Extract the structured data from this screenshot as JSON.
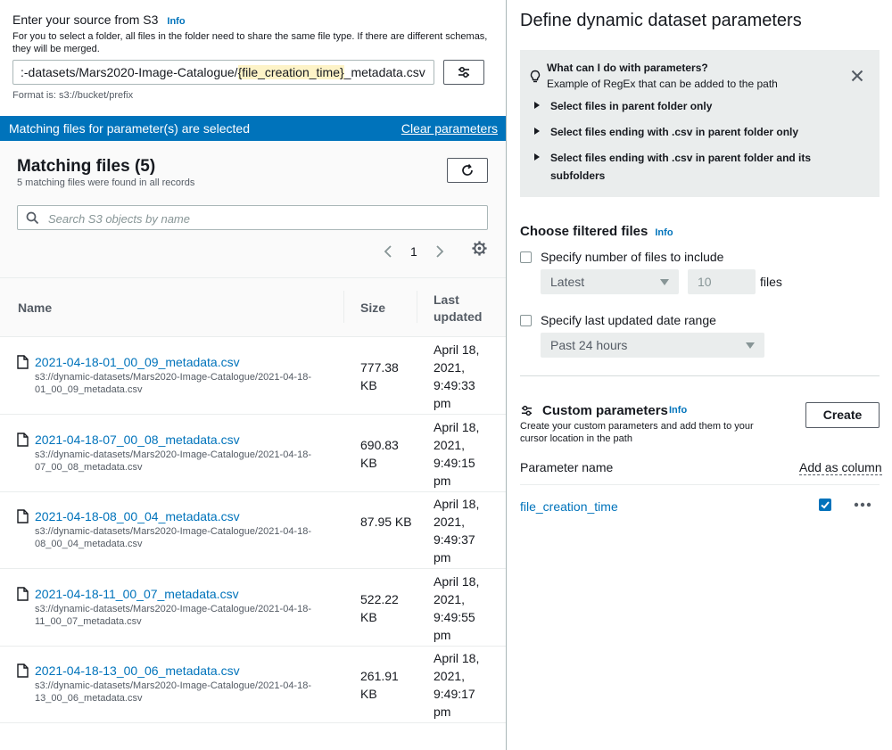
{
  "left": {
    "source_title": "Enter your source from S3",
    "info": "Info",
    "source_description": "For you to select a folder, all files in the folder need to share the same file type. If there are different schemas, they will be merged.",
    "path_prefix": ":-datasets/Mars2020-Image-Catalogue/",
    "path_param": "{file_creation_time}",
    "path_suffix": "_metadata.csv",
    "format_hint": "Format is: s3://bucket/prefix",
    "banner_message": "Matching files for parameter(s) are selected",
    "clear_parameters": "Clear parameters",
    "matching_title": "Matching files (5)",
    "matching_subtitle": "5 matching files were found in all records",
    "search_placeholder": "Search S3 objects by name",
    "page_number": "1",
    "columns": {
      "name": "Name",
      "size": "Size",
      "last_updated": "Last updated"
    },
    "files": [
      {
        "name": "2021-04-18-01_00_09_metadata.csv",
        "path": "s3://dynamic-datasets/Mars2020-Image-Catalogue/2021-04-18-01_00_09_metadata.csv",
        "size": "777.38 KB",
        "updated": "April 18, 2021, 9:49:33 pm"
      },
      {
        "name": "2021-04-18-07_00_08_metadata.csv",
        "path": "s3://dynamic-datasets/Mars2020-Image-Catalogue/2021-04-18-07_00_08_metadata.csv",
        "size": "690.83 KB",
        "updated": "April 18, 2021, 9:49:15 pm"
      },
      {
        "name": "2021-04-18-08_00_04_metadata.csv",
        "path": "s3://dynamic-datasets/Mars2020-Image-Catalogue/2021-04-18-08_00_04_metadata.csv",
        "size": "87.95 KB",
        "updated": "April 18, 2021, 9:49:37 pm"
      },
      {
        "name": "2021-04-18-11_00_07_metadata.csv",
        "path": "s3://dynamic-datasets/Mars2020-Image-Catalogue/2021-04-18-11_00_07_metadata.csv",
        "size": "522.22 KB",
        "updated": "April 18, 2021, 9:49:55 pm"
      },
      {
        "name": "2021-04-18-13_00_06_metadata.csv",
        "path": "s3://dynamic-datasets/Mars2020-Image-Catalogue/2021-04-18-13_00_06_metadata.csv",
        "size": "261.91 KB",
        "updated": "April 18, 2021, 9:49:17 pm"
      }
    ]
  },
  "right": {
    "title": "Define dynamic dataset parameters",
    "help_question": "What can I do with parameters?",
    "help_example": "Example of RegEx that can be added to the path",
    "help_items": [
      "Select files in parent folder only",
      "Select files ending with .csv in parent folder only",
      "Select files ending with .csv in parent folder and its",
      "subfolders"
    ],
    "choose_title": "Choose filtered files",
    "info": "Info",
    "specify_number_label": "Specify number of files to include",
    "latest": "Latest",
    "count_placeholder": "10",
    "files_label": "files",
    "specify_date_label": "Specify last updated date range",
    "date_range": "Past 24 hours",
    "custom_title": "Custom parameters",
    "custom_desc": "Create your custom parameters and add them to your cursor location in the path",
    "create_label": "Create",
    "param_name_header": "Parameter name",
    "add_as_column": "Add as column",
    "param_name": "file_creation_time"
  }
}
